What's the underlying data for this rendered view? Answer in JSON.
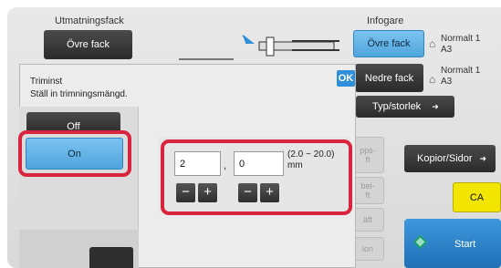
{
  "header": {
    "output_tray_label": "Utmatningsfack",
    "insert_label": "Infogare"
  },
  "buttons": {
    "upper_tray_left": "Övre fack",
    "upper_tray_right": "Övre fack",
    "lower_tray": "Nedre fack",
    "type_size": "Typ/storlek",
    "copies_pages": "Kopior/Sidor",
    "ca": "CA",
    "start": "Start"
  },
  "tray_status": [
    {
      "label": "Normalt 1",
      "size": "A3"
    },
    {
      "label": "Normalt 1",
      "size": "A3"
    }
  ],
  "dialog": {
    "title": "Triminst",
    "instruction": "Ställ in trimningsmängd.",
    "ok": "OK",
    "off": "Off",
    "on": "On",
    "value1": "2",
    "separator": ",",
    "value2": "0",
    "range": "(2.0 ~ 20.0)",
    "unit": "mm",
    "minus": "−",
    "plus": "+"
  },
  "obscured": {
    "btn_a": "pps-\nft",
    "btn_b": "bel-\nft",
    "btn_c": "äft",
    "btn_d": "ion"
  },
  "colors": {
    "accent_blue": "#4fa5dc",
    "highlight_red": "#d9243e",
    "ca_yellow": "#f2e600",
    "start_blue": "#1f7ec8"
  }
}
